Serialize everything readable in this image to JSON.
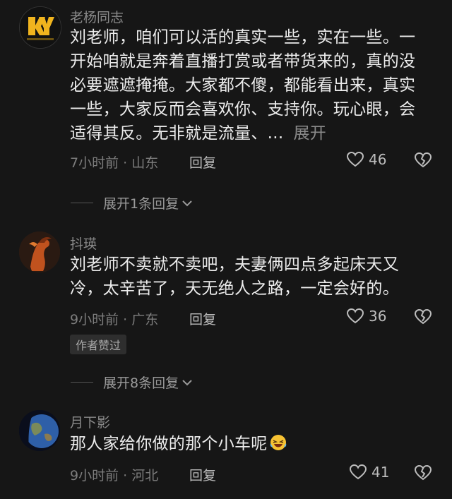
{
  "comments": [
    {
      "username": "老杨同志",
      "text": "刘老师，咱们可以活的真实一些，实在一些。一开始咱就是奔着直播打赏或者带货来的，真的没必要遮遮掩掩。大家都不傻，都能看出来，真实一些，大家反而会喜欢你、支持你。玩心眼，会适得其反。无非就是流量、...",
      "more_label": "展开",
      "time_location": "7小时前 · 山东",
      "reply_label": "回复",
      "likes": "46",
      "expand_label": "展开1条回复",
      "avatar_text": "KY"
    },
    {
      "username": "抖瑛",
      "text": "刘老师不卖就不卖吧，夫妻俩四点多起床天又冷，太辛苦了，天无绝人之路，一定会好的。",
      "time_location": "9小时前 · 广东",
      "reply_label": "回复",
      "likes": "36",
      "badge": "作者赞过",
      "expand_label": "展开8条回复"
    },
    {
      "username": "月下影",
      "text": "那人家给你做的那个小车呢",
      "time_location": "9小时前 · 河北",
      "reply_label": "回复",
      "likes": "41"
    }
  ],
  "icons": {
    "like": "heart-outline-icon",
    "dislike": "broken-heart-icon",
    "expand": "chevron-down-icon",
    "emoji": "laughing-face-emoji-icon"
  },
  "colors": {
    "background": "#161616",
    "text": "#ececec",
    "muted": "#7d7d7d",
    "avatar_gold": "#f0b41e"
  }
}
